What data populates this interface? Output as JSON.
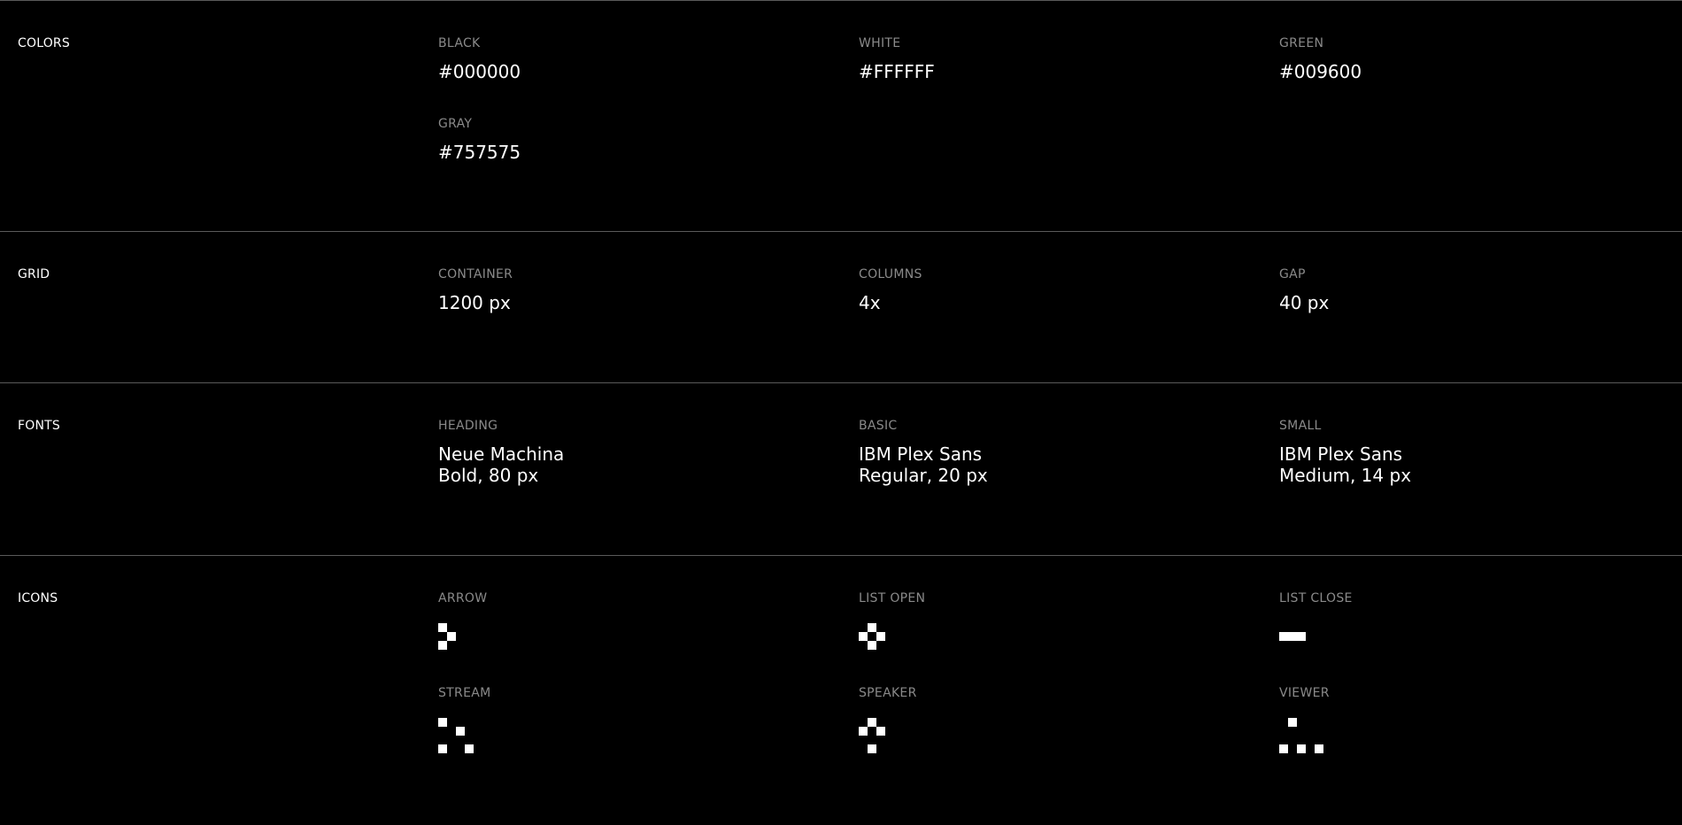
{
  "sections": {
    "colors": {
      "title": "COLORS",
      "items": [
        {
          "label": "BLACK",
          "value": "#000000"
        },
        {
          "label": "WHITE",
          "value": "#FFFFFF"
        },
        {
          "label": "GREEN",
          "value": "#009600"
        },
        {
          "label": "GRAY",
          "value": "#757575"
        }
      ]
    },
    "grid": {
      "title": "GRID",
      "items": [
        {
          "label": "CONTAINER",
          "value": "1200 px"
        },
        {
          "label": "COLUMNS",
          "value": "4x"
        },
        {
          "label": "GAP",
          "value": "40 px"
        }
      ]
    },
    "fonts": {
      "title": "FONTS",
      "items": [
        {
          "label": "HEADING",
          "value": "Neue Machina\nBold, 80 px"
        },
        {
          "label": "BASIC",
          "value": "IBM Plex Sans\nRegular, 20 px"
        },
        {
          "label": "SMALL",
          "value": "IBM Plex Sans\nMedium, 14 px"
        }
      ]
    },
    "icons": {
      "title": "ICONS",
      "items": [
        {
          "label": "ARROW",
          "icon": "arrow-icon"
        },
        {
          "label": "LIST OPEN",
          "icon": "list-open-icon"
        },
        {
          "label": "LIST CLOSE",
          "icon": "list-close-icon"
        },
        {
          "label": "STREAM",
          "icon": "stream-icon"
        },
        {
          "label": "SPEAKER",
          "icon": "speaker-icon"
        },
        {
          "label": "VIEWER",
          "icon": "viewer-icon"
        }
      ]
    }
  },
  "colors": {
    "background": "#000000",
    "text": "#FFFFFF",
    "muted": "#8A8A8A",
    "divider": "#5A5A5A"
  }
}
